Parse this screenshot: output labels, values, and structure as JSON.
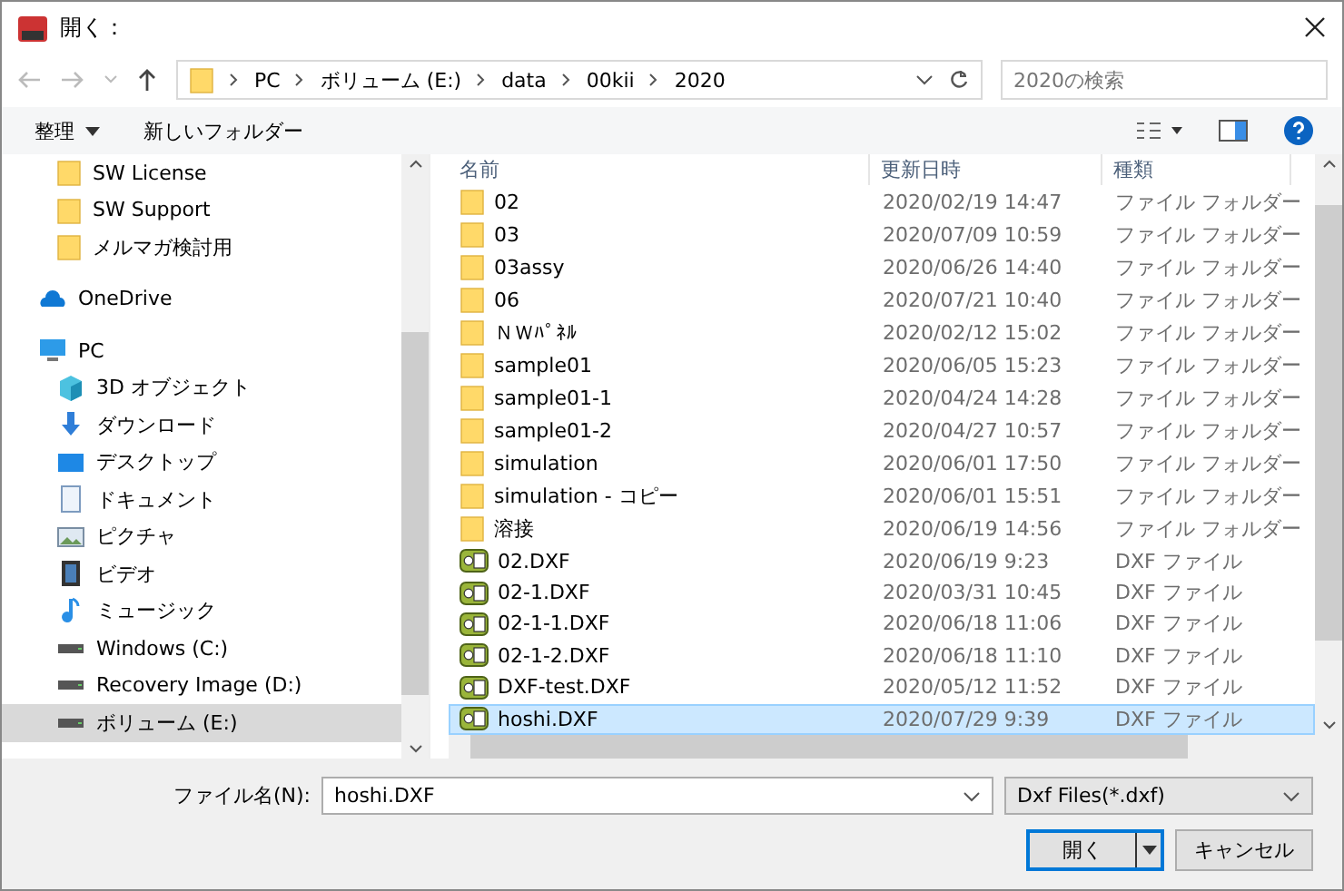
{
  "window": {
    "title": "開く："
  },
  "address": {
    "crumbs": [
      "PC",
      "ボリューム (E:)",
      "data",
      "00kii",
      "2020"
    ]
  },
  "search": {
    "placeholder": "2020の検索"
  },
  "toolbar": {
    "organize": "整理",
    "new_folder": "新しいフォルダー"
  },
  "sidebar": {
    "items": [
      {
        "kind": "folder",
        "label": "SW License",
        "selected": false
      },
      {
        "kind": "folder",
        "label": "SW Support",
        "selected": false
      },
      {
        "kind": "folder",
        "label": "メルマガ検討用",
        "selected": false
      },
      {
        "kind": "cloud",
        "label": "OneDrive",
        "selected": false
      },
      {
        "kind": "pc",
        "label": "PC",
        "selected": false,
        "children": [
          {
            "kind": "cube",
            "label": "3D オブジェクト",
            "selected": false
          },
          {
            "kind": "download",
            "label": "ダウンロード",
            "selected": false
          },
          {
            "kind": "desktop",
            "label": "デスクトップ",
            "selected": false
          },
          {
            "kind": "document",
            "label": "ドキュメント",
            "selected": false
          },
          {
            "kind": "picture",
            "label": "ピクチャ",
            "selected": false
          },
          {
            "kind": "video",
            "label": "ビデオ",
            "selected": false
          },
          {
            "kind": "music",
            "label": "ミュージック",
            "selected": false
          },
          {
            "kind": "drive",
            "label": "Windows (C:)",
            "selected": false
          },
          {
            "kind": "drive",
            "label": "Recovery Image (D:)",
            "selected": false
          },
          {
            "kind": "drive",
            "label": "ボリューム (E:)",
            "selected": true
          }
        ]
      }
    ]
  },
  "table": {
    "columns": [
      "名前",
      "更新日時",
      "種類"
    ],
    "rows": [
      {
        "kind": "folder",
        "name": "02",
        "date": "2020/02/19 14:47",
        "type": "ファイル フォルダー",
        "selected": false
      },
      {
        "kind": "folder",
        "name": "03",
        "date": "2020/07/09 10:59",
        "type": "ファイル フォルダー",
        "selected": false
      },
      {
        "kind": "folder",
        "name": "03assy",
        "date": "2020/06/26 14:40",
        "type": "ファイル フォルダー",
        "selected": false
      },
      {
        "kind": "folder",
        "name": "06",
        "date": "2020/07/21 10:40",
        "type": "ファイル フォルダー",
        "selected": false
      },
      {
        "kind": "folder",
        "name": "ＮＷﾊﾟﾈﾙ",
        "date": "2020/02/12 15:02",
        "type": "ファイル フォルダー",
        "selected": false
      },
      {
        "kind": "folder",
        "name": "sample01",
        "date": "2020/06/05 15:23",
        "type": "ファイル フォルダー",
        "selected": false
      },
      {
        "kind": "folder",
        "name": "sample01-1",
        "date": "2020/04/24 14:28",
        "type": "ファイル フォルダー",
        "selected": false
      },
      {
        "kind": "folder",
        "name": "sample01-2",
        "date": "2020/04/27 10:57",
        "type": "ファイル フォルダー",
        "selected": false
      },
      {
        "kind": "folder",
        "name": "simulation",
        "date": "2020/06/01 17:50",
        "type": "ファイル フォルダー",
        "selected": false
      },
      {
        "kind": "folder",
        "name": "simulation - コピー",
        "date": "2020/06/01 15:51",
        "type": "ファイル フォルダー",
        "selected": false
      },
      {
        "kind": "folder",
        "name": "溶接",
        "date": "2020/06/19 14:56",
        "type": "ファイル フォルダー",
        "selected": false
      },
      {
        "kind": "dxf",
        "name": "02.DXF",
        "date": "2020/06/19 9:23",
        "type": "DXF ファイル",
        "selected": false
      },
      {
        "kind": "dxf",
        "name": "02-1.DXF",
        "date": "2020/03/31 10:45",
        "type": "DXF ファイル",
        "selected": false
      },
      {
        "kind": "dxf",
        "name": "02-1-1.DXF",
        "date": "2020/06/18 11:06",
        "type": "DXF ファイル",
        "selected": false
      },
      {
        "kind": "dxf",
        "name": "02-1-2.DXF",
        "date": "2020/06/18 11:10",
        "type": "DXF ファイル",
        "selected": false
      },
      {
        "kind": "dxf",
        "name": "DXF-test.DXF",
        "date": "2020/05/12 11:52",
        "type": "DXF ファイル",
        "selected": false
      },
      {
        "kind": "dxf",
        "name": "hoshi.DXF",
        "date": "2020/07/29 9:39",
        "type": "DXF ファイル",
        "selected": true
      }
    ]
  },
  "footer": {
    "filename_label": "ファイル名(N):",
    "filename": "hoshi.DXF",
    "filter": "Dxf Files(*.dxf)",
    "open": "開く",
    "cancel": "キャンセル"
  }
}
